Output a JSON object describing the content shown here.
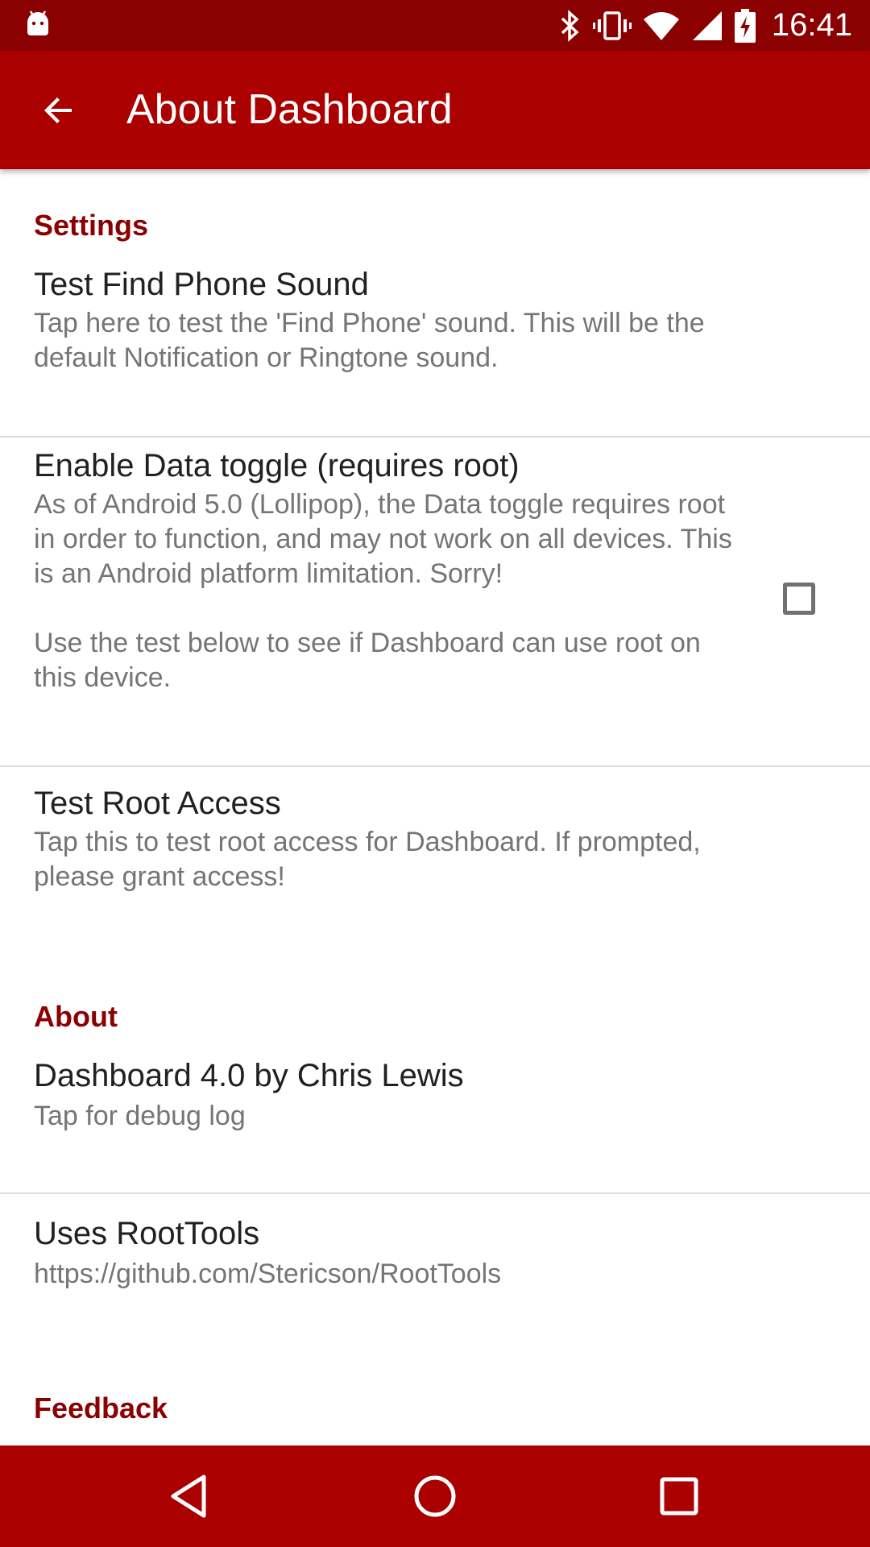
{
  "status_bar": {
    "time": "16:41",
    "icons": [
      "android-icon",
      "bluetooth-icon",
      "vibrate-icon",
      "wifi-icon",
      "signal-icon",
      "battery-charging-icon"
    ]
  },
  "app_bar": {
    "title": "About Dashboard",
    "back_icon": "arrow-back-icon"
  },
  "sections": {
    "settings": {
      "header": "Settings",
      "find_phone": {
        "title": "Test Find Phone Sound",
        "summary": "Tap here to test the 'Find Phone' sound. This will be the default Notification or Ringtone sound."
      },
      "data_toggle": {
        "title": "Enable Data toggle (requires root)",
        "summary_1": "As of Android 5.0 (Lollipop), the Data toggle requires root in order to function, and may not work on all devices. This is an Android platform limitation. Sorry!",
        "summary_2": "Use the test below to see if Dashboard can use root on this device.",
        "checked": false
      },
      "root_access": {
        "title": "Test Root Access",
        "summary": "Tap this to test root access for Dashboard. If prompted, please grant access!"
      }
    },
    "about": {
      "header": "About",
      "version": {
        "title": "Dashboard 4.0 by Chris Lewis",
        "summary": "Tap for debug log"
      },
      "roottools": {
        "title": "Uses RootTools",
        "summary": "https://github.com/Stericson/RootTools"
      }
    },
    "feedback": {
      "header": "Feedback"
    }
  },
  "nav_bar": {
    "icons": [
      "nav-back-icon",
      "nav-home-icon",
      "nav-recents-icon"
    ]
  },
  "colors": {
    "status_bar": "#8b0000",
    "app_bar": "#aa0000",
    "accent": "#8b0000",
    "nav_bar": "#aa0000"
  }
}
